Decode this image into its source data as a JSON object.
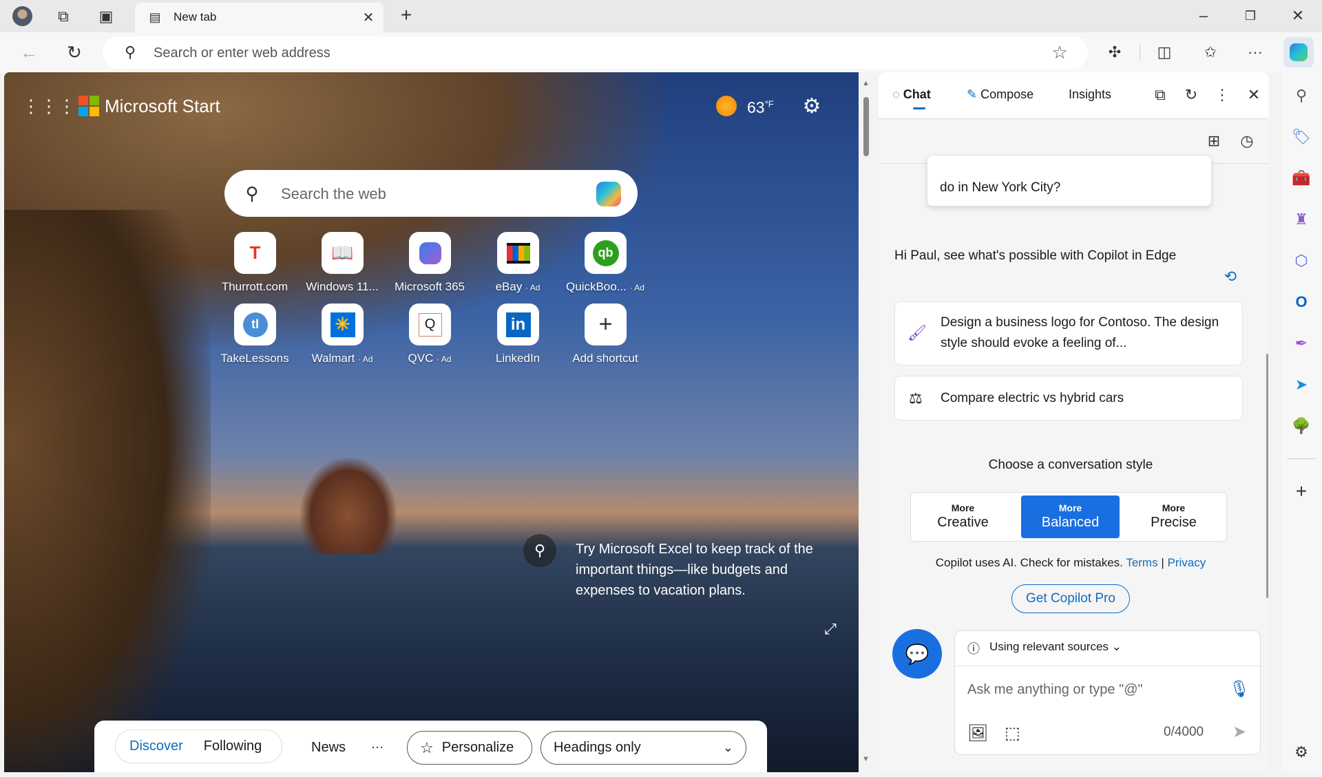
{
  "browser": {
    "tab_title": "New tab",
    "address_placeholder": "Search or enter web address"
  },
  "page": {
    "brand": "Microsoft Start",
    "temperature": "63",
    "temp_unit": "°F",
    "search_placeholder": "Search the web",
    "shortcuts": [
      {
        "label": "Thurrott.com",
        "ad": ""
      },
      {
        "label": "Windows 11...",
        "ad": ""
      },
      {
        "label": "Microsoft 365",
        "ad": ""
      },
      {
        "label": "eBay",
        "ad": "· Ad"
      },
      {
        "label": "QuickBoo...",
        "ad": "· Ad"
      },
      {
        "label": "TakeLessons",
        "ad": ""
      },
      {
        "label": "Walmart",
        "ad": "· Ad"
      },
      {
        "label": "QVC",
        "ad": "· Ad"
      },
      {
        "label": "LinkedIn",
        "ad": ""
      },
      {
        "label": "Add shortcut",
        "ad": ""
      }
    ],
    "info_text": "Try Microsoft Excel to keep track of the important things—like budgets and expenses to vacation plans.",
    "feed": {
      "discover": "Discover",
      "following": "Following",
      "news": "News",
      "more": "···",
      "personalize": "Personalize",
      "layout": "Headings only"
    }
  },
  "copilot": {
    "tabs": [
      "Chat",
      "Compose",
      "Insights"
    ],
    "prev_question": "do in New York City?",
    "greeting": "Hi Paul, see what's possible with Copilot in Edge",
    "suggestions": [
      "Design a business logo for Contoso. The design style should evoke a feeling of...",
      "Compare electric vs hybrid cars"
    ],
    "style_heading": "Choose a conversation style",
    "styles": [
      {
        "top": "More",
        "main": "Creative"
      },
      {
        "top": "More",
        "main": "Balanced"
      },
      {
        "top": "More",
        "main": "Precise"
      }
    ],
    "disclaimer": "Copilot uses AI. Check for mistakes.",
    "terms": "Terms",
    "sep": "|",
    "privacy": "Privacy",
    "pro_button": "Get Copilot Pro",
    "sources": "Using relevant sources",
    "input_placeholder": "Ask me anything or type \"@\"",
    "char_count": "0/4000"
  },
  "colors": {
    "accent": "#0f6cbd",
    "balanced": "#1a6fe0"
  }
}
